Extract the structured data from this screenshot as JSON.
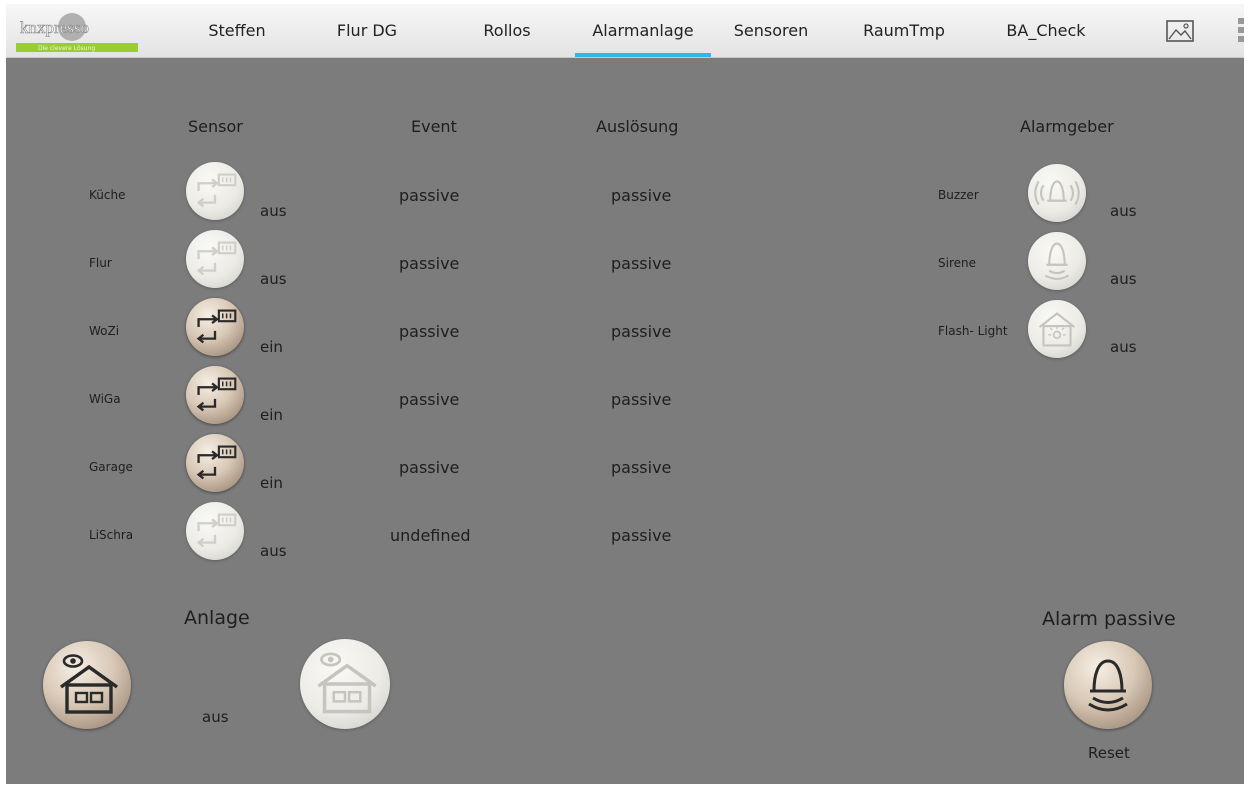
{
  "brand": {
    "logo_text": "knxpresso",
    "logo_tagline": "Die clevere Lösung"
  },
  "tabs": [
    {
      "label": "Steffen",
      "active": false
    },
    {
      "label": "Flur DG",
      "active": false
    },
    {
      "label": "Rollos",
      "active": false
    },
    {
      "label": "Alarmanlage",
      "active": true
    },
    {
      "label": "Sensoren",
      "active": false
    },
    {
      "label": "RaumTmp",
      "active": false
    },
    {
      "label": "BA_Check",
      "active": false
    }
  ],
  "toolbar_icons": [
    "image-icon",
    "overflow-menu-icon"
  ],
  "colors": {
    "accent": "#33b5e5",
    "background": "#7c7c7c"
  },
  "headers": {
    "sensor": "Sensor",
    "event": "Event",
    "ausloesung": "Auslösung",
    "alarmgeber": "Alarmgeber"
  },
  "sensors": [
    {
      "name": "Küche",
      "state": "aus",
      "event": "passive",
      "trigger": "passive"
    },
    {
      "name": "Flur",
      "state": "aus",
      "event": "passive",
      "trigger": "passive"
    },
    {
      "name": "WoZi",
      "state": "ein",
      "event": "passive",
      "trigger": "passive"
    },
    {
      "name": "WiGa",
      "state": "ein",
      "event": "passive",
      "trigger": "passive"
    },
    {
      "name": "Garage",
      "state": "ein",
      "event": "passive",
      "trigger": "passive"
    },
    {
      "name": "LiSchra",
      "state": "aus",
      "event": "undefined",
      "trigger": "passive"
    }
  ],
  "alarm_devices": [
    {
      "name": "Buzzer",
      "state": "aus",
      "icon": "buzzer-bell-icon"
    },
    {
      "name": "Sirene",
      "state": "aus",
      "icon": "siren-bell-icon"
    },
    {
      "name": "Flash-  Light",
      "state": "aus",
      "icon": "flash-light-house-icon"
    }
  ],
  "anlage": {
    "title": "Anlage",
    "state": "aus"
  },
  "alarm": {
    "status": "Alarm passive",
    "reset_label": "Reset"
  }
}
